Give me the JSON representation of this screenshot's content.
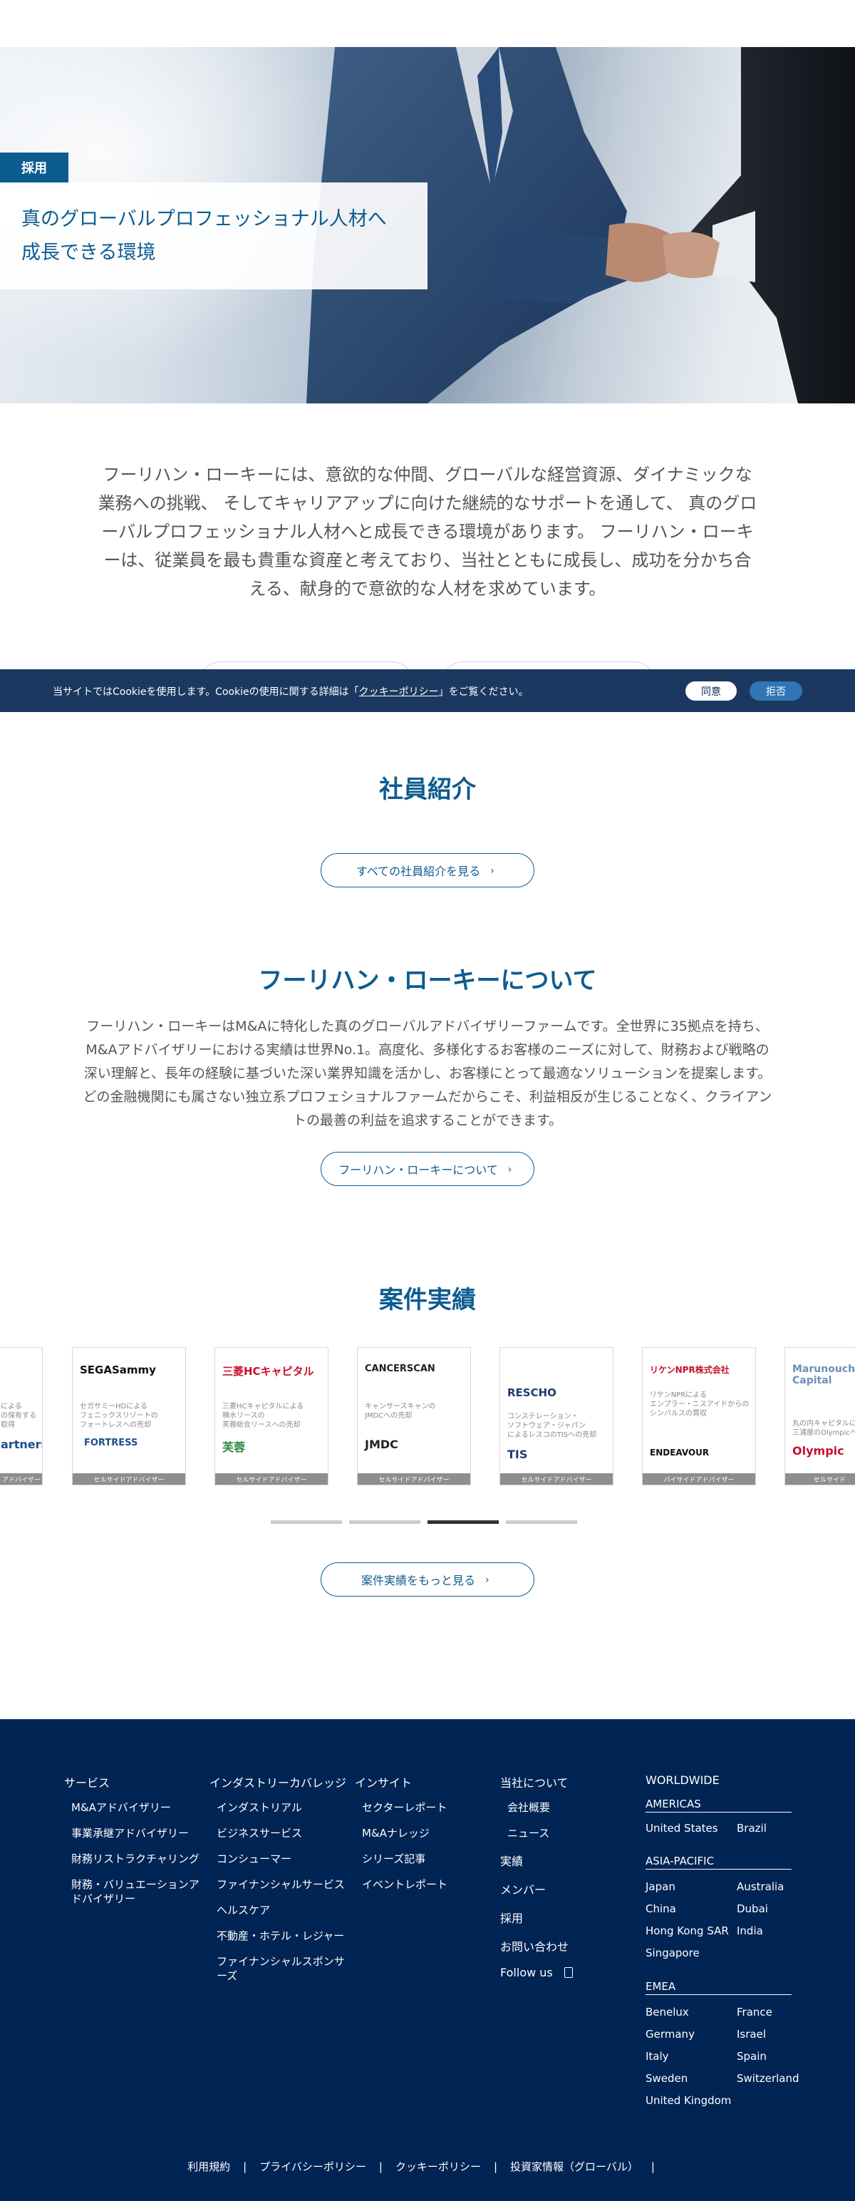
{
  "hero": {
    "tag": "採用",
    "title_lines": [
      "真のグローバルプロフェッショナル人材へ",
      "成長できる環境"
    ]
  },
  "intro": {
    "lines": [
      "フーリハン・ローキーには、意欲的な仲間、グローバルな経営資源、ダイナミックな",
      "業務への挑戦、 そしてキャリアアップに向けた継続的なサポートを通して、 真のグロ",
      "ーバルプロフェッショナル人材へと成長できる環境があります。 フーリハン・ローキ",
      "ーは、従業員を最も貴重な資産と考えており、当社とともに成長し、成功を分かち合",
      "える、献身的で意欲的な人材を求めています。"
    ]
  },
  "cookie": {
    "message_before": "当サイトではCookieを使用します。Cookieの使用に関する詳細は「",
    "policy_link": "クッキーポリシー",
    "message_after": "」をご覧ください。",
    "agree": "同意",
    "reject": "拒否"
  },
  "staff": {
    "title": "社員紹介",
    "button": "すべての社員紹介を見る"
  },
  "about": {
    "title": "フーリハン・ローキーについて",
    "lines": [
      "フーリハン・ローキーはM&Aに特化した真のグローバルアドバイザリーファームです。全世界に35拠点を持ち、",
      "M&Aアドバイザリーにおける実績は世界No.1。高度化、多様化するお客様のニーズに対して、財務および戦略の",
      "深い理解と、長年の経験に基づいた深い業界知識を活かし、お客様にとって最適なソリューションを提案します。",
      "どの金融機関にも属さない独立系プロフェショナルファームだからこそ、利益相反が生じることなく、クライアン",
      "トの最善の利益を追求することができます。"
    ],
    "button": "フーリハン・ローキーについて"
  },
  "deals": {
    "title": "案件実績",
    "cards": [
      {
        "logo_a": "",
        "desc": "による\nの保有する\n取得",
        "logo_b": "artners",
        "role": "アドバイザー",
        "color_a": "#333",
        "color_b": "#1f4e8c"
      },
      {
        "logo_a": "SEGASammy",
        "desc": "セガサミーHDによる\nフェニックスリゾートの\nフォートレスへの売却",
        "logo_b": "FORTRESS",
        "role": "セルサイドアドバイザー",
        "color_a": "#111",
        "color_b": "#1f4e8c"
      },
      {
        "logo_a": "三菱HCキャピタル",
        "desc": "三菱HCキャピタルによる\n積水リースの\n芙蓉総合リースへの売却",
        "logo_b": "芙蓉",
        "role": "セルサイドアドバイザー",
        "color_a": "#c8102e",
        "color_b": "#2a8a3e"
      },
      {
        "logo_a": "CANCERSCAN",
        "desc": "キャンサースキャンの\nJMDCへの売却",
        "logo_b": "JMDC",
        "role": "セルサイドアドバイザー",
        "color_a": "#222",
        "color_b": "#222"
      },
      {
        "logo_a": "RESCHO",
        "desc": "コンステレーション・\nソフトウェア・ジャパン\nによるレスコのTISへの売却",
        "logo_b": "TIS",
        "role": "セルサイドアドバイザー",
        "color_a": "#1f3d6b",
        "color_b": "#1f3d6b"
      },
      {
        "logo_a": "リケンNPR株式会社",
        "desc": "リケンNPRによる\nエンプラー・ニスアイドからの\nシンバルスの買収",
        "logo_b": "ENDEAVOUR",
        "role": "バイサイドアドバイザー",
        "color_a": "#c8102e",
        "color_b": "#111"
      },
      {
        "logo_a": "Marunouchi Capital",
        "desc": "丸の内キャピタルによる\n三浦屋のOlympicへの",
        "logo_b": "Olympic",
        "role": "セルサイド",
        "color_a": "#6b8fb5",
        "color_b": "#c8102e"
      }
    ],
    "button": "案件実績をもっと見る"
  },
  "footer": {
    "services": {
      "heading": "サービス",
      "items": [
        "M&Aアドバイザリー",
        "事業承継アドバイザリー",
        "財務リストラクチャリング",
        "財務・バリュエーションアドバイザリー"
      ]
    },
    "industries": {
      "heading": "インダストリーカバレッジ",
      "items": [
        "インダストリアル",
        "ビジネスサービス",
        "コンシューマー",
        "ファイナンシャルサービス",
        "ヘルスケア",
        "不動産・ホテル・レジャー",
        "ファイナンシャルスポンサーズ"
      ]
    },
    "insights": {
      "heading": "インサイト",
      "items": [
        "セクターレポート",
        "M&Aナレッジ",
        "シリーズ記事",
        "イベントレポート"
      ]
    },
    "company": {
      "heading": "当社について",
      "items": [
        "会社概要",
        "ニュース"
      ],
      "links": [
        "実績",
        "メンバー",
        "採用",
        "お問い合わせ"
      ],
      "follow": "Follow us"
    },
    "worldwide": {
      "heading": "WORLDWIDE",
      "americas": {
        "heading": "AMERICAS",
        "cities": [
          "United States",
          "Brazil"
        ]
      },
      "apac": {
        "heading": "ASIA-PACIFIC",
        "cities": [
          "Japan",
          "Australia",
          "China",
          "Dubai",
          "Hong Kong SAR",
          "India",
          "Singapore"
        ]
      },
      "emea": {
        "heading": "EMEA",
        "cities": [
          "Benelux",
          "France",
          "Germany",
          "Israel",
          "Italy",
          "Spain",
          "Sweden",
          "Switzerland",
          "United Kingdom"
        ]
      }
    },
    "legal": [
      "利用規約",
      "プライバシーポリシー",
      "クッキーポリシー",
      "投資家情報（グローバル）"
    ]
  }
}
